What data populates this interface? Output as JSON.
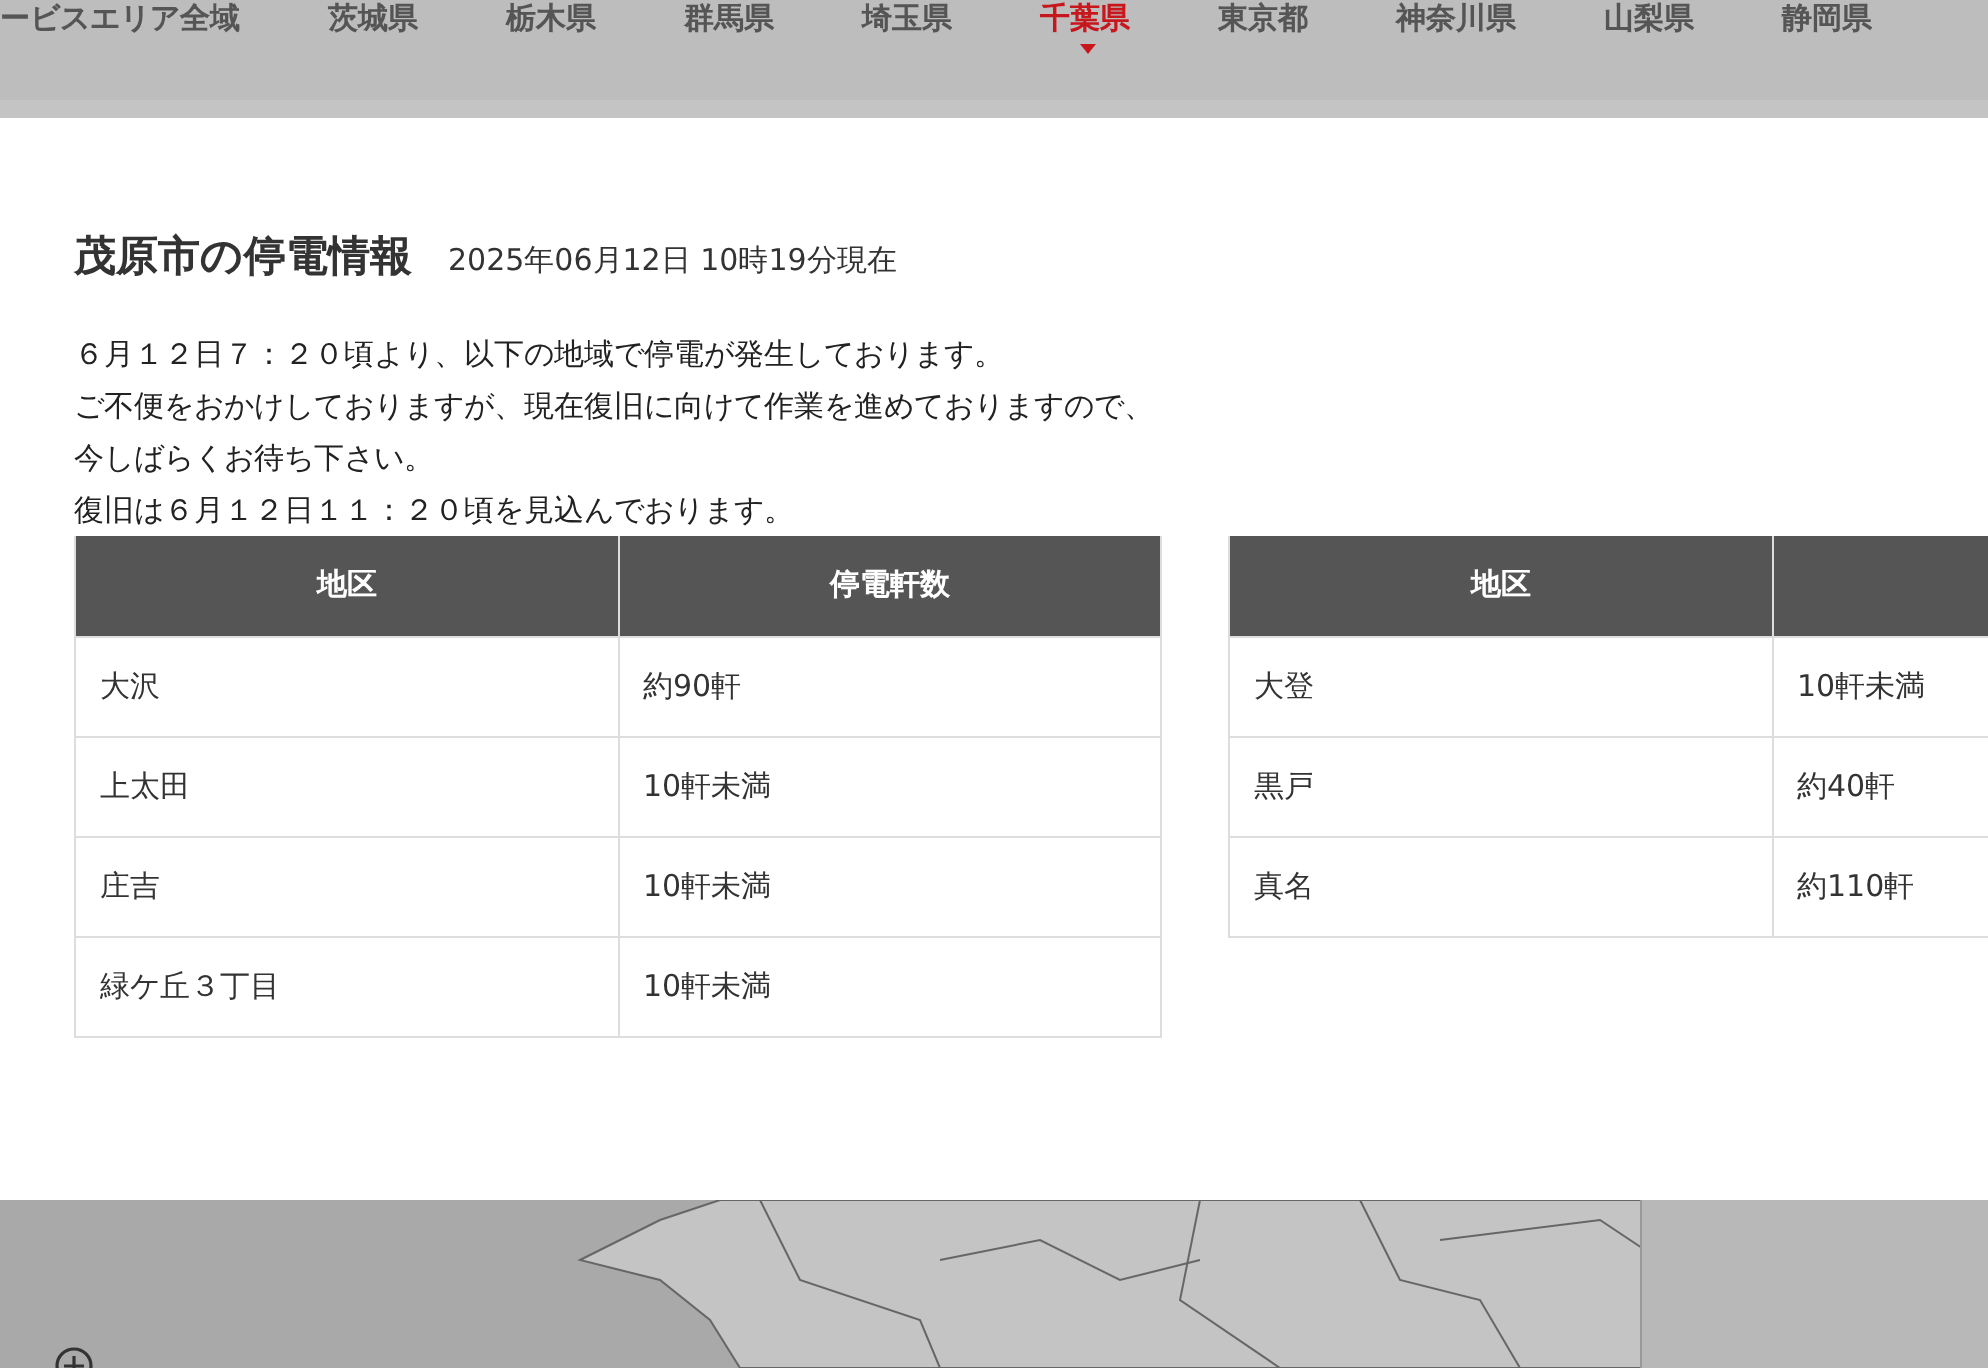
{
  "nav": [
    {
      "label": "ービスエリア全域",
      "selected": false
    },
    {
      "label": "茨城県",
      "selected": false
    },
    {
      "label": "栃木県",
      "selected": false
    },
    {
      "label": "群馬県",
      "selected": false
    },
    {
      "label": "埼玉県",
      "selected": false
    },
    {
      "label": "千葉県",
      "selected": true
    },
    {
      "label": "東京都",
      "selected": false
    },
    {
      "label": "神奈川県",
      "selected": false
    },
    {
      "label": "山梨県",
      "selected": false
    },
    {
      "label": "静岡県",
      "selected": false
    }
  ],
  "modal": {
    "title": "茂原市の停電情報",
    "timestamp": "2025年06月12日 10時19分現在",
    "message": [
      "６月１２日７：２０頃より、以下の地域で停電が発生しております。",
      "ご不便をおかけしておりますが、現在復旧に向けて作業を進めておりますので、",
      "今しばらくお待ち下さい。",
      "復旧は６月１２日１１：２０頃を見込んでおります。"
    ],
    "tables": [
      {
        "columns": [
          "地区",
          "停電軒数"
        ],
        "rows": [
          [
            "大沢",
            "約90軒"
          ],
          [
            "上太田",
            "10軒未満"
          ],
          [
            "庄吉",
            "10軒未満"
          ],
          [
            "緑ケ丘３丁目",
            "10軒未満"
          ]
        ]
      },
      {
        "columns": [
          "地区"
        ],
        "rows": [
          [
            "大登",
            "10軒未満"
          ],
          [
            "黒戸",
            "約40軒"
          ],
          [
            "真名",
            "約110軒"
          ]
        ]
      }
    ]
  }
}
